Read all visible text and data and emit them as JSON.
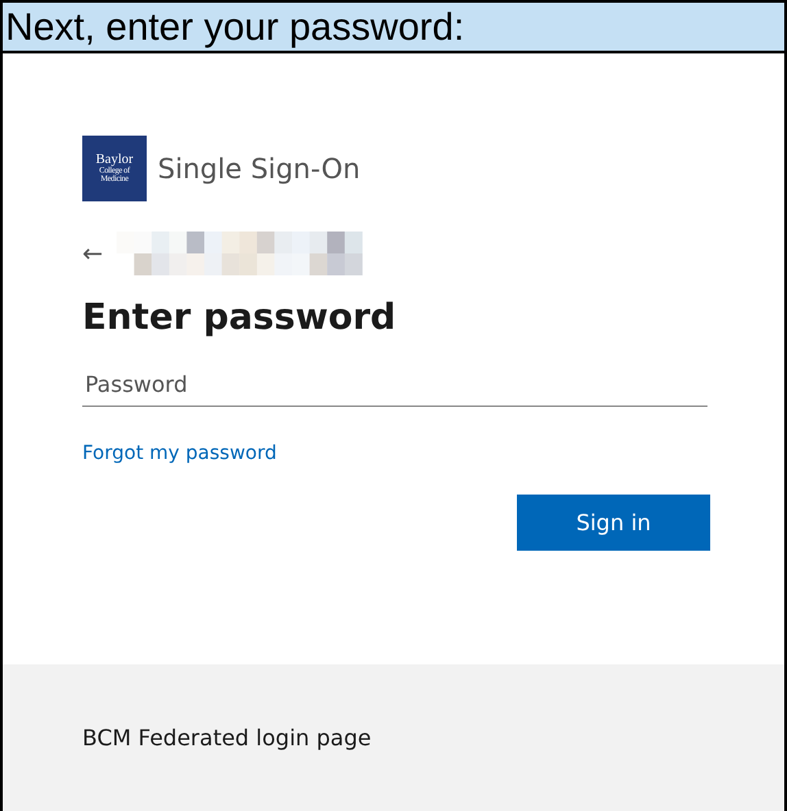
{
  "caption": "Next, enter your password:",
  "brand": {
    "logo_lines": [
      "Baylor",
      "College of",
      "Medicine"
    ],
    "title": "Single Sign-On"
  },
  "back": "←",
  "heading": "Enter password",
  "password_field": {
    "placeholder": "Password"
  },
  "forgot_link": "Forgot my password",
  "buttons": [
    "Sign in"
  ],
  "footer": "BCM Federated login page"
}
